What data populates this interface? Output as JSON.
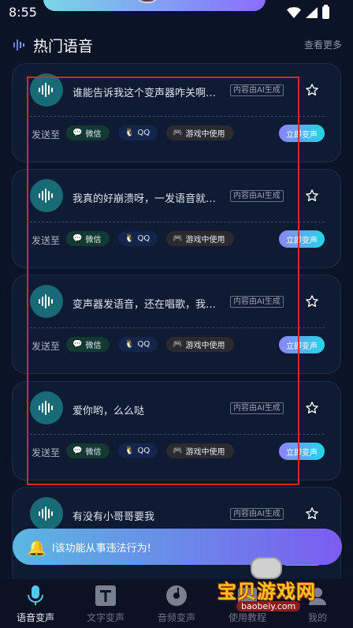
{
  "status_bar": {
    "time": "8:55"
  },
  "section": {
    "title": "热门语音",
    "more": "查看更多"
  },
  "common": {
    "send_to": "发送至",
    "ai_tag": "内容由AI生成",
    "chips": {
      "wechat": "微信",
      "qq": "QQ",
      "game": "游戏中使用"
    },
    "convert": "立即变声"
  },
  "cards": [
    {
      "title": "谁能告诉我这个变声器咋关啊…"
    },
    {
      "title": "我真的好崩溃呀，一发语音就…"
    },
    {
      "title": "变声器发语音，还在唱歌，我…"
    },
    {
      "title": "爱你哟，么么哒"
    },
    {
      "title": "有没有小哥哥要我"
    }
  ],
  "toast": {
    "text": "l该功能从事违法行为!"
  },
  "nav": [
    {
      "label": "语音变声",
      "active": true,
      "icon": "microphone-icon"
    },
    {
      "label": "文字变声",
      "active": false,
      "icon": "text-t-icon"
    },
    {
      "label": "音频变声",
      "active": false,
      "icon": "music-disc-icon"
    },
    {
      "label": "使用教程",
      "active": false,
      "icon": "tutorial-icon"
    },
    {
      "label": "我的",
      "active": false,
      "icon": "user-icon"
    }
  ],
  "watermark": {
    "text": "宝贝游戏网",
    "url": "baobeiy.com"
  },
  "colors": {
    "background": "#0b1326",
    "card": "#0f1a33",
    "accent_gradient_start": "#8e83ff",
    "accent_gradient_end": "#22d6e6",
    "highlight_box": "#d8262b"
  }
}
